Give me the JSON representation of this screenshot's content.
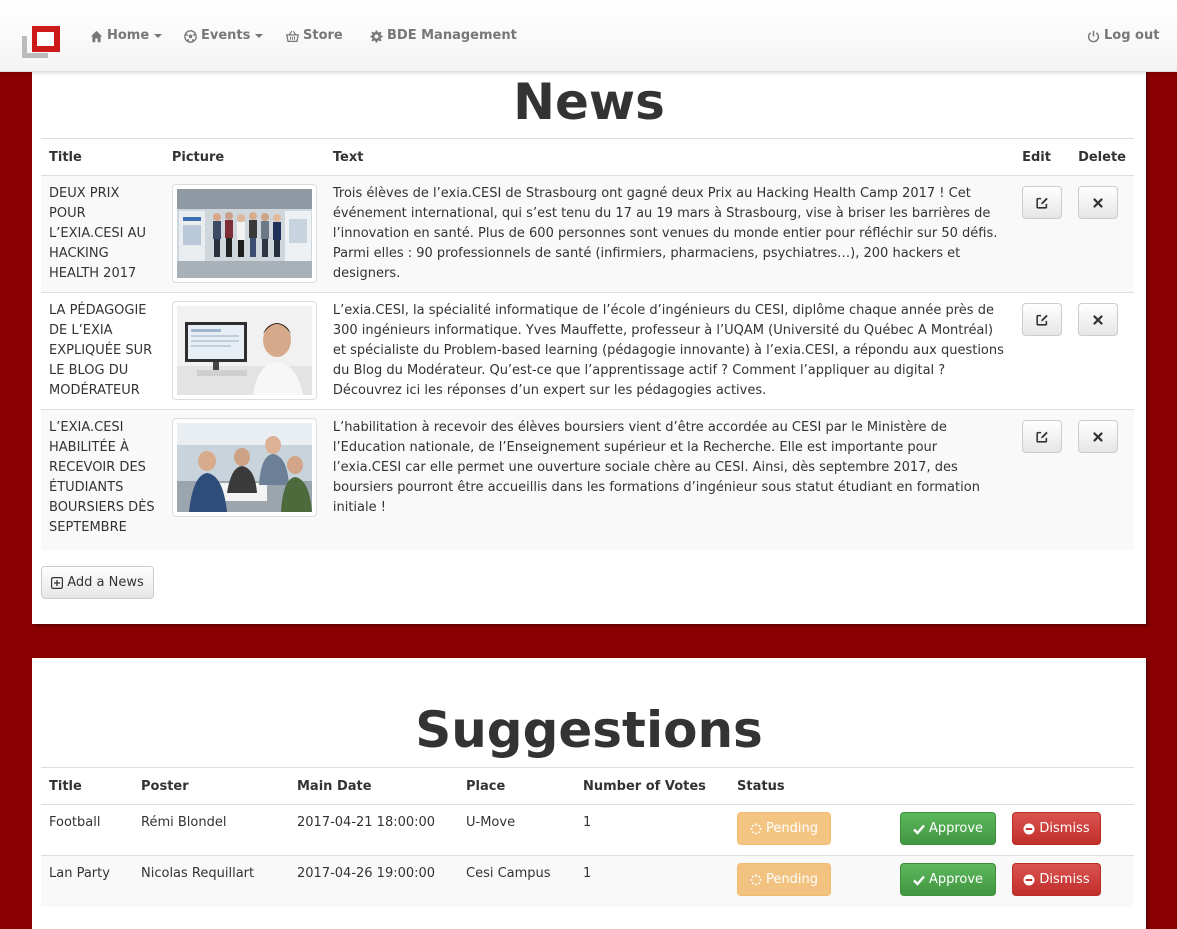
{
  "nav": {
    "home": "Home",
    "events": "Events",
    "store": "Store",
    "bde": "BDE Management",
    "logout": "Log out"
  },
  "news": {
    "title": "News",
    "headers": {
      "title": "Title",
      "picture": "Picture",
      "text": "Text",
      "edit": "Edit",
      "delete": "Delete"
    },
    "items": [
      {
        "title": "DEUX PRIX POUR L’EXIA.CESI AU HACKING HEALTH 2017",
        "text": "Trois élèves de l’exia.CESI de Strasbourg ont gagné deux Prix au Hacking Health Camp 2017 ! Cet événement international, qui s’est tenu du 17 au 19 mars à Strasbourg, vise à briser les barrières de l’innovation en santé. Plus de 600 personnes sont venues du monde entier pour réfléchir sur 50 défis. Parmi elles : 90 professionnels de santé (infirmiers, pharmaciens, psychiatres…), 200 hackers et designers."
      },
      {
        "title": "LA PÉDAGOGIE DE L’EXIA EXPLIQUÉE SUR LE BLOG DU MODÉRATEUR",
        "text": "L’exia.CESI, la spécialité informatique de l’école d’ingénieurs du CESI, diplôme chaque année près de 300 ingénieurs informatique. Yves Mauffette, professeur à l’UQAM (Université du Québec A Montréal) et spécialiste du Problem-based learning (pédagogie innovante) à l’exia.CESI, a répondu aux questions du Blog du Modérateur. Qu’est-ce que l’apprentissage actif ? Comment l’appliquer au digital ? Découvrez ici les réponses d’un expert sur les pédagogies actives."
      },
      {
        "title": "L’EXIA.CESI HABILITÉE À RECEVOIR DES ÉTUDIANTS BOURSIERS DÈS SEPTEMBRE",
        "text": "L’habilitation à recevoir des élèves boursiers vient d’être accordée au CESI par le Ministère de l’Education nationale, de l’Enseignement supérieur et la Recherche. Elle est importante pour l’exia.CESI car elle permet une ouverture sociale chère au CESI. Ainsi, dès septembre 2017, des boursiers pourront être accueillis dans les formations d’ingénieur sous statut étudiant en formation initiale !"
      }
    ],
    "add_label": "Add a News"
  },
  "suggestions": {
    "title": "Suggestions",
    "headers": {
      "title": "Title",
      "poster": "Poster",
      "date": "Main Date",
      "place": "Place",
      "votes": "Number of Votes",
      "status": "Status"
    },
    "rows": [
      {
        "title": "Football",
        "poster": "Rémi Blondel",
        "date": "2017-04-21 18:00:00",
        "place": "U-Move",
        "votes": "1",
        "status": "Pending"
      },
      {
        "title": "Lan Party",
        "poster": "Nicolas Requillart",
        "date": "2017-04-26 19:00:00",
        "place": "Cesi Campus",
        "votes": "1",
        "status": "Pending"
      }
    ],
    "approve_label": "Approve",
    "dismiss_label": "Dismiss"
  }
}
